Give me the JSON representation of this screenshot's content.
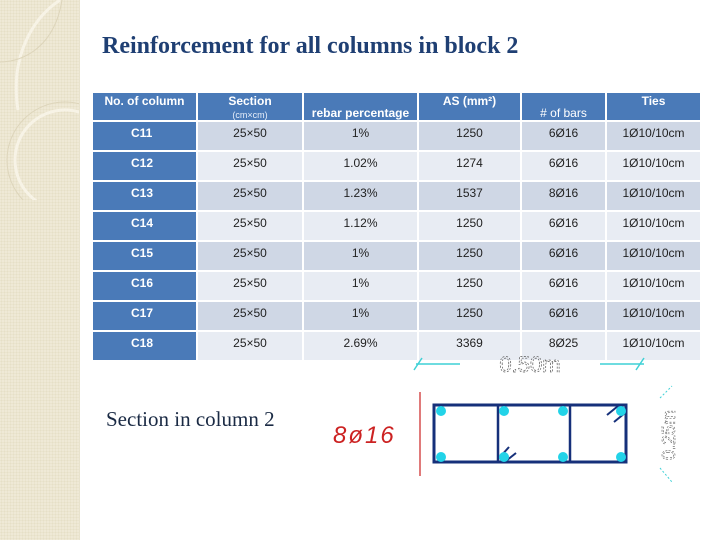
{
  "title": "Reinforcement for all columns in block 2",
  "table": {
    "headers": {
      "col_no": "No. of column",
      "section": "Section",
      "section_unit": "(cm×cm)",
      "rebar_percentage": "rebar percentage",
      "as": "AS (mm²)",
      "num_bars": "# of  bars",
      "ties": "Ties"
    },
    "rows": [
      {
        "column": "C11",
        "section": "25×50",
        "rebar_percentage": "1%",
        "as": "1250",
        "bars": "6Ø16",
        "ties": "1Ø10/10cm"
      },
      {
        "column": "C12",
        "section": "25×50",
        "rebar_percentage": "1.02%",
        "as": "1274",
        "bars": "6Ø16",
        "ties": "1Ø10/10cm"
      },
      {
        "column": "C13",
        "section": "25×50",
        "rebar_percentage": "1.23%",
        "as": "1537",
        "bars": "8Ø16",
        "ties": "1Ø10/10cm"
      },
      {
        "column": "C14",
        "section": "25×50",
        "rebar_percentage": "1.12%",
        "as": "1250",
        "bars": "6Ø16",
        "ties": "1Ø10/10cm"
      },
      {
        "column": "C15",
        "section": "25×50",
        "rebar_percentage": "1%",
        "as": "1250",
        "bars": "6Ø16",
        "ties": "1Ø10/10cm"
      },
      {
        "column": "C16",
        "section": "25×50",
        "rebar_percentage": "1%",
        "as": "1250",
        "bars": "6Ø16",
        "ties": "1Ø10/10cm"
      },
      {
        "column": "C17",
        "section": "25×50",
        "rebar_percentage": "1%",
        "as": "1250",
        "bars": "6Ø16",
        "ties": "1Ø10/10cm"
      },
      {
        "column": "C18",
        "section": "25×50",
        "rebar_percentage": "2.69%",
        "as": "3369",
        "bars": "8Ø25",
        "ties": "1Ø10/10cm"
      }
    ]
  },
  "section_caption": "Section in column 2",
  "drawing": {
    "bar_label": "8ø16",
    "width_label": "0.50m",
    "height_label": "0.25m",
    "colors": {
      "stirrup": "#16307a",
      "bar": "#22d3e8",
      "dimension": "#3fd1d6",
      "label_red": "#cc2222"
    }
  }
}
